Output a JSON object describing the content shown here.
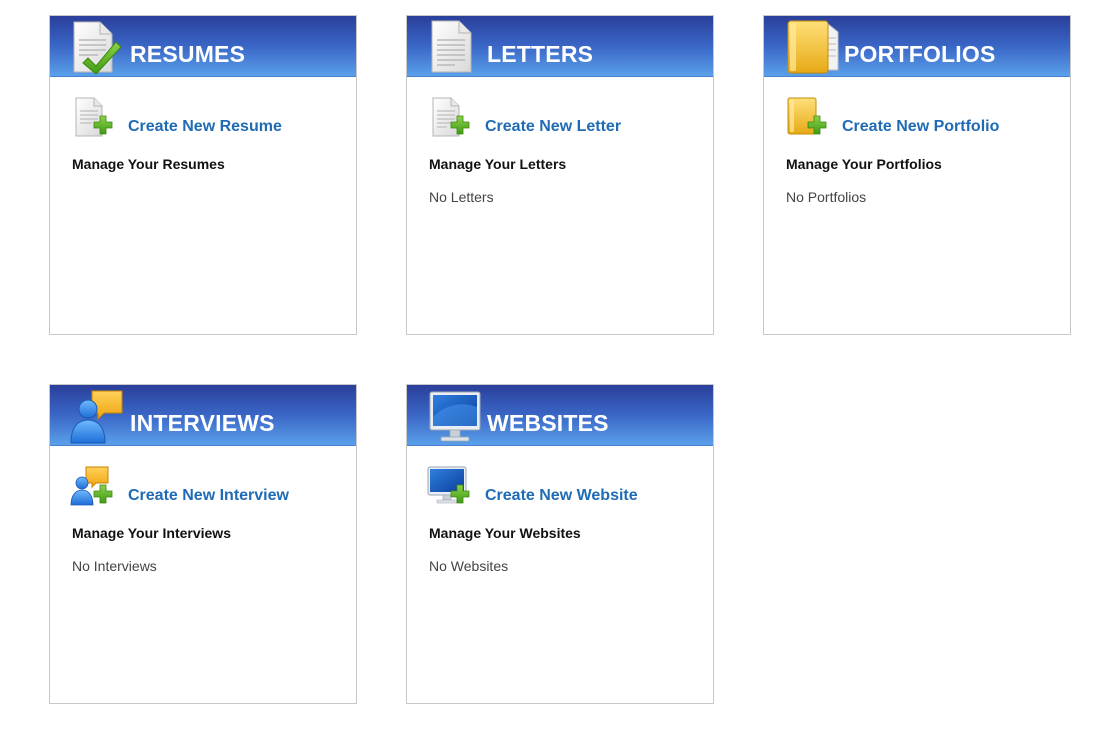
{
  "cards": {
    "resumes": {
      "title": "RESUMES",
      "header_icon": "resume-document-check-icon",
      "create_label": "Create New Resume",
      "create_icon": "add-document-icon",
      "manage_title": "Manage Your Resumes",
      "empty_text": ""
    },
    "letters": {
      "title": "LETTERS",
      "header_icon": "letter-document-icon",
      "create_label": "Create New Letter",
      "create_icon": "add-letter-icon",
      "manage_title": "Manage Your Letters",
      "empty_text": "No Letters"
    },
    "portfolios": {
      "title": "PORTFOLIOS",
      "header_icon": "folder-icon",
      "create_label": "Create New Portfolio",
      "create_icon": "add-folder-icon",
      "manage_title": "Manage Your Portfolios",
      "empty_text": "No Portfolios"
    },
    "interviews": {
      "title": "INTERVIEWS",
      "header_icon": "person-speech-bubble-icon",
      "create_label": "Create New Interview",
      "create_icon": "add-interview-icon",
      "manage_title": "Manage Your Interviews",
      "empty_text": "No Interviews"
    },
    "websites": {
      "title": "WEBSITES",
      "header_icon": "monitor-icon",
      "create_label": "Create New Website",
      "create_icon": "add-website-icon",
      "manage_title": "Manage Your Websites",
      "empty_text": "No Websites"
    }
  },
  "colors": {
    "header_gradient_top": "#2a3f9a",
    "header_gradient_bottom": "#5aa0ea",
    "link": "#1f6bb5",
    "plus_green": "#5fb624",
    "check_green": "#4fa81b",
    "folder_yellow": "#f2c230"
  }
}
